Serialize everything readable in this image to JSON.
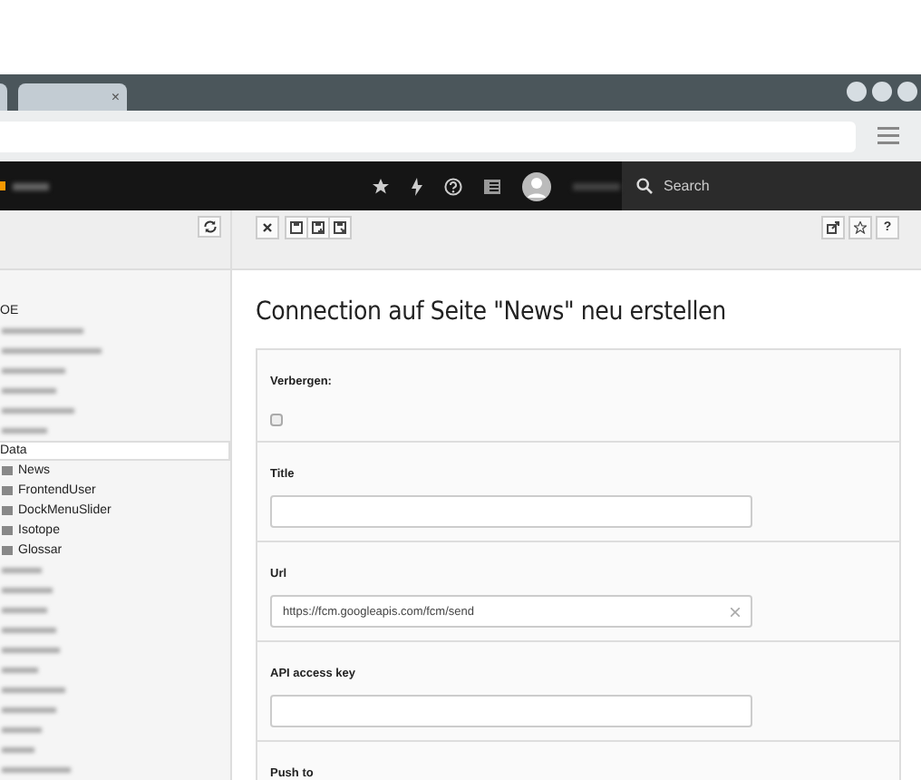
{
  "browser": {
    "tab_close": "×"
  },
  "topbar": {
    "search_placeholder": "Search"
  },
  "tree": {
    "items": [
      {
        "kind": "text",
        "label": "OE",
        "selected": false
      },
      {
        "kind": "blurred",
        "selected": false
      },
      {
        "kind": "blurred",
        "selected": false
      },
      {
        "kind": "blurred",
        "selected": false
      },
      {
        "kind": "blurred",
        "selected": false
      },
      {
        "kind": "blurred",
        "selected": false
      },
      {
        "kind": "blurred",
        "selected": false
      },
      {
        "kind": "text",
        "label": "Data",
        "selected": true,
        "children": [
          {
            "kind": "folder",
            "label": "News",
            "selected": false
          },
          {
            "kind": "folder",
            "label": "FrontendUser",
            "selected": false
          },
          {
            "kind": "folder",
            "label": "DockMenuSlider",
            "selected": false
          },
          {
            "kind": "folder",
            "label": "Isotope",
            "selected": false
          },
          {
            "kind": "folder",
            "label": "Glossar",
            "selected": false
          }
        ]
      },
      {
        "kind": "blurred",
        "selected": false
      },
      {
        "kind": "blurred",
        "selected": false
      },
      {
        "kind": "blurred",
        "selected": false
      },
      {
        "kind": "blurred",
        "selected": false
      },
      {
        "kind": "blurred",
        "selected": false
      },
      {
        "kind": "blurred",
        "selected": false
      },
      {
        "kind": "blurred",
        "selected": false
      },
      {
        "kind": "blurred",
        "selected": false
      },
      {
        "kind": "blurred",
        "selected": false
      },
      {
        "kind": "blurred",
        "selected": false
      },
      {
        "kind": "blurred",
        "selected": false
      }
    ]
  },
  "docheader": {
    "help_label": "?"
  },
  "form": {
    "title": "Connection auf Seite \"News\" neu erstellen",
    "fields": [
      {
        "kind": "checkbox",
        "label": "Verbergen:",
        "checked": false
      },
      {
        "kind": "text",
        "label": "Title",
        "clearable": false
      },
      {
        "kind": "text",
        "label": "Url",
        "value": "https://fcm.googleapis.com/fcm/send",
        "clearable": true
      },
      {
        "kind": "text",
        "label": "API access key",
        "clearable": false
      },
      {
        "kind": "heading",
        "label": "Push to"
      }
    ]
  }
}
